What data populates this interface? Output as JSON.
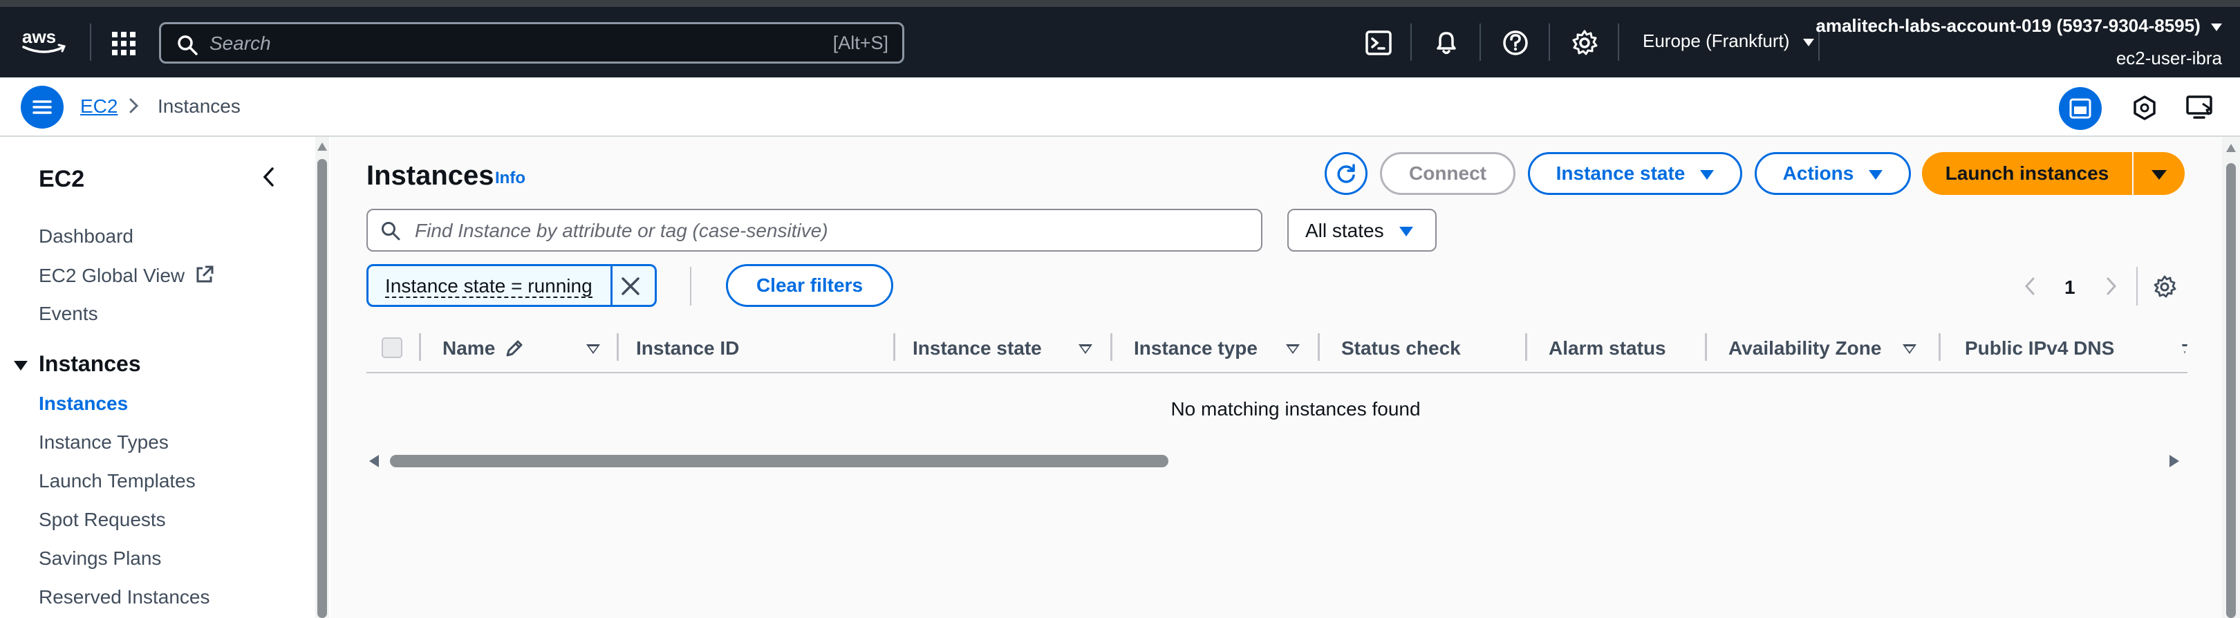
{
  "topnav": {
    "logo_text": "aws",
    "search_placeholder": "Search",
    "search_shortcut": "[Alt+S]",
    "region": "Europe (Frankfurt)",
    "account_name": "amalitech-labs-account-019 (5937-9304-8595)",
    "account_user": "ec2-user-ibra",
    "icons": [
      "cloudshell-icon",
      "bell-icon",
      "help-icon",
      "gear-icon"
    ],
    "colors": {
      "background": "#161d26",
      "text": "#ffffff"
    }
  },
  "breadcrumb": {
    "parent": "EC2",
    "current": "Instances"
  },
  "sidebar": {
    "title": "EC2",
    "top_items": [
      {
        "label": "Dashboard"
      },
      {
        "label": "EC2 Global View"
      },
      {
        "label": "Events"
      }
    ],
    "section": "Instances",
    "section_items": [
      {
        "label": "Instances",
        "active": true
      },
      {
        "label": "Instance Types"
      },
      {
        "label": "Launch Templates"
      },
      {
        "label": "Spot Requests"
      },
      {
        "label": "Savings Plans"
      },
      {
        "label": "Reserved Instances"
      }
    ]
  },
  "main": {
    "title": "Instances",
    "info": "Info",
    "buttons": {
      "connect": "Connect",
      "instance_state": "Instance state",
      "actions": "Actions",
      "launch": "Launch instances"
    },
    "filter_placeholder": "Find Instance by attribute or tag (case-sensitive)",
    "states_select": "All states",
    "filter_token": "Instance state = running",
    "clear_filters": "Clear filters",
    "page_number": "1",
    "columns": [
      "Name",
      "Instance ID",
      "Instance state",
      "Instance type",
      "Status check",
      "Alarm status",
      "Availability Zone",
      "Public IPv4 DNS"
    ],
    "empty_message": "No matching instances found"
  },
  "colors": {
    "accent": "#006ce0",
    "launch": "#ff9900",
    "disabled": "#8c8c94"
  }
}
